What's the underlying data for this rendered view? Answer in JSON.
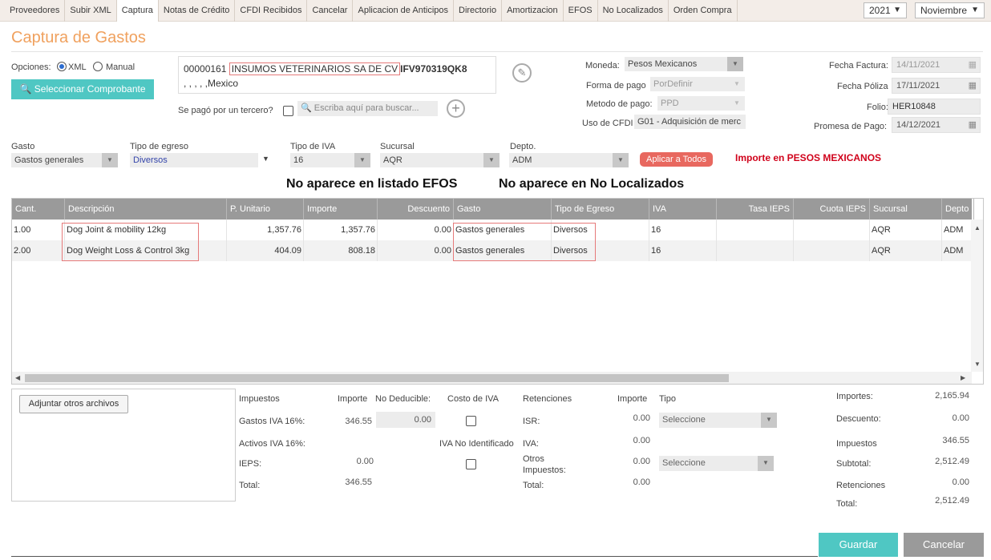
{
  "nav": {
    "items": [
      "Proveedores",
      "Subir XML",
      "Captura",
      "Notas de Crédito",
      "CFDI Recibidos",
      "Cancelar",
      "Aplicacion de Anticipos",
      "Directorio",
      "Amortizacion",
      "EFOS",
      "No Localizados",
      "Orden Compra"
    ],
    "active_index": 2,
    "year": "2021",
    "month": "Noviembre"
  },
  "page": {
    "title": "Captura de Gastos"
  },
  "opciones": {
    "label": "Opciones:",
    "xml_label": "XML",
    "manual_label": "Manual",
    "selected": "XML",
    "select_button": "Seleccionar Comprobante"
  },
  "provider": {
    "code": "00000161",
    "name": "INSUMOS VETERINARIOS SA DE CV",
    "rfc": "IFV970319QK8",
    "address": ", , , , ,Mexico",
    "third_party_label": "Se pagó por un tercero?",
    "search_placeholder": "Escriba aquí para buscar..."
  },
  "payment": {
    "moneda_label": "Moneda:",
    "moneda": "Pesos Mexicanos",
    "forma_label": "Forma de pago",
    "forma": "PorDefinir",
    "metodo_label": "Metodo de pago:",
    "metodo": "PPD",
    "uso_label": "Uso de CFDI",
    "uso": "G01 - Adquisición de merc"
  },
  "dates": {
    "factura_label": "Fecha Factura:",
    "factura": "14/11/2021",
    "poliza_label": "Fecha Póliza",
    "poliza": "17/11/2021",
    "folio_label": "Folio:",
    "folio": "HER10848",
    "promesa_label": "Promesa de Pago:",
    "promesa": "14/12/2021"
  },
  "filters": {
    "gasto_label": "Gasto",
    "gasto": "Gastos generales",
    "tipo_egreso_label": "Tipo de egreso",
    "tipo_egreso": "Diversos",
    "tipo_iva_label": "Tipo de IVA",
    "tipo_iva": "16",
    "sucursal_label": "Sucursal",
    "sucursal": "AQR",
    "depto_label": "Depto.",
    "depto": "ADM",
    "apply_all": "Aplicar a Todos",
    "currency_note": "Importe en PESOS MEXICANOS"
  },
  "notices": {
    "efos": "No aparece en listado EFOS",
    "no_localizados": "No aparece en No Localizados"
  },
  "table": {
    "columns": [
      "Cant.",
      "Descripción",
      "P. Unitario",
      "Importe",
      "Descuento",
      "Gasto",
      "Tipo de Egreso",
      "IVA",
      "Tasa IEPS",
      "Cuota IEPS",
      "Sucursal",
      "Depto"
    ],
    "rows": [
      [
        "1.00",
        "Dog Joint & mobility 12kg",
        "1,357.76",
        "1,357.76",
        "0.00",
        "Gastos generales",
        "Diversos",
        "16",
        "",
        "",
        "AQR",
        "ADM"
      ],
      [
        "2.00",
        "Dog Weight Loss & Control 3kg",
        "404.09",
        "808.18",
        "0.00",
        "Gastos generales",
        "Diversos",
        "16",
        "",
        "",
        "AQR",
        "ADM"
      ]
    ]
  },
  "attachments": {
    "button": "Adjuntar otros archivos"
  },
  "taxes": {
    "impuestos_label": "Impuestos",
    "importe_label": "Importe",
    "no_deducible_label": "No Deducible:",
    "costo_iva_label": "Costo de IVA",
    "gastos_iva_label": "Gastos IVA 16%:",
    "gastos_iva": "346.55",
    "no_deducible": "0.00",
    "activos_iva_label": "Activos IVA 16%:",
    "iva_no_ident_label": "IVA No Identificado",
    "ieps_label": "IEPS:",
    "ieps": "0.00",
    "total_label": "Total:",
    "total": "346.55"
  },
  "retenciones": {
    "label": "Retenciones",
    "importe_label": "Importe",
    "tipo_label": "Tipo",
    "isr_label": "ISR:",
    "isr": "0.00",
    "iva_label": "IVA:",
    "iva": "0.00",
    "otros_label": "Otros Impuestos:",
    "otros": "0.00",
    "total_label": "Total:",
    "total": "0.00",
    "tipo_placeholder": "Seleccione"
  },
  "totals": {
    "importes_label": "Importes:",
    "importes": "2,165.94",
    "descuento_label": "Descuento:",
    "descuento": "0.00",
    "impuestos_label": "Impuestos",
    "impuestos": "346.55",
    "subtotal_label": "Subtotal:",
    "subtotal": "2,512.49",
    "retenciones_label": "Retenciones",
    "retenciones": "0.00",
    "total_label": "Total:",
    "total": "2,512.49"
  },
  "actions": {
    "save": "Guardar",
    "cancel": "Cancelar"
  },
  "colors": {
    "accent": "#f0a15e",
    "teal": "#4fc7c3",
    "red_note": "#d0021b",
    "apply_btn": "#e8685f"
  }
}
